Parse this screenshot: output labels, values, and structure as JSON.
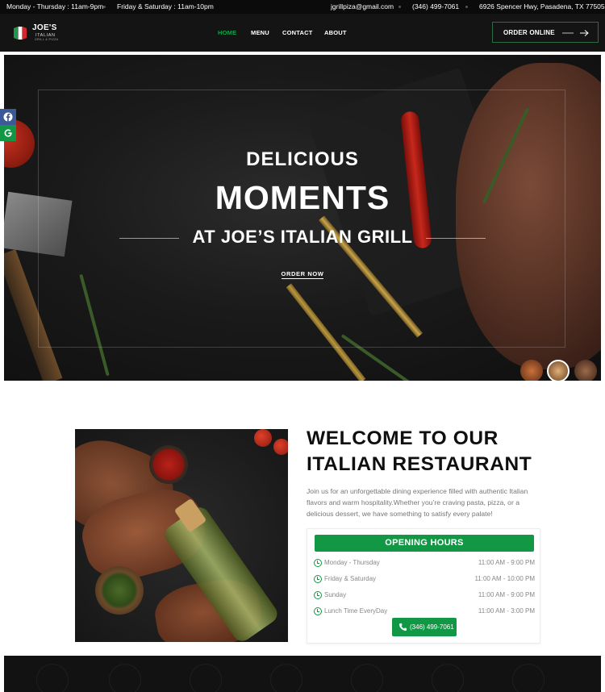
{
  "topbar": {
    "hours_weekday": "Monday - Thursday : 11am-9pm",
    "hours_weekend": "Friday & Saturday : 11am-10pm",
    "email": "jgrillpiza@gmail.com",
    "phone": "(346) 499-7061",
    "address": "6926 Spencer Hwy, Pasadena, TX 77505"
  },
  "header": {
    "logo": {
      "name": "JOE'S",
      "sub": "ITALIAN",
      "sub2": "GRILL & PIZZA"
    },
    "nav": [
      {
        "label": "HOME",
        "active": true
      },
      {
        "label": "MENU",
        "active": false
      },
      {
        "label": "CONTACT",
        "active": false
      },
      {
        "label": "ABOUT",
        "active": false
      }
    ],
    "order_button": "ORDER ONLINE"
  },
  "social": {
    "facebook": "facebook-icon",
    "google": "google-icon"
  },
  "hero": {
    "line1": "DELICIOUS",
    "line2": "MOMENTS",
    "line3": "AT JOE’S ITALIAN GRILL",
    "cta": "ORDER NOW",
    "slides_count": 3,
    "active_slide": 2
  },
  "welcome": {
    "title_line1": "WELCOME TO OUR",
    "title_line2": "ITALIAN RESTAURANT",
    "text": "Join us for an unforgettable dining experience filled with authentic Italian flavors and warm hospitality.Whether you’re craving pasta, pizza, or a delicious dessert, we have something to satisfy every palate!"
  },
  "hours": {
    "title": "OPENING HOURS",
    "rows": [
      {
        "day": "Monday - Thursday",
        "time": "11:00 AM - 9:00 PM"
      },
      {
        "day": "Friday & Saturday",
        "time": "11:00 AM - 10:00 PM"
      },
      {
        "day": "Sunday",
        "time": "11:00 AM - 9:00 PM"
      },
      {
        "day": "Lunch Time EveryDay",
        "time": "11:00 AM - 3:00 PM"
      }
    ],
    "call_button": "(346) 499-7061"
  },
  "colors": {
    "accent": "#129745",
    "dark": "#141414",
    "topbar": "#0b0b0b"
  }
}
